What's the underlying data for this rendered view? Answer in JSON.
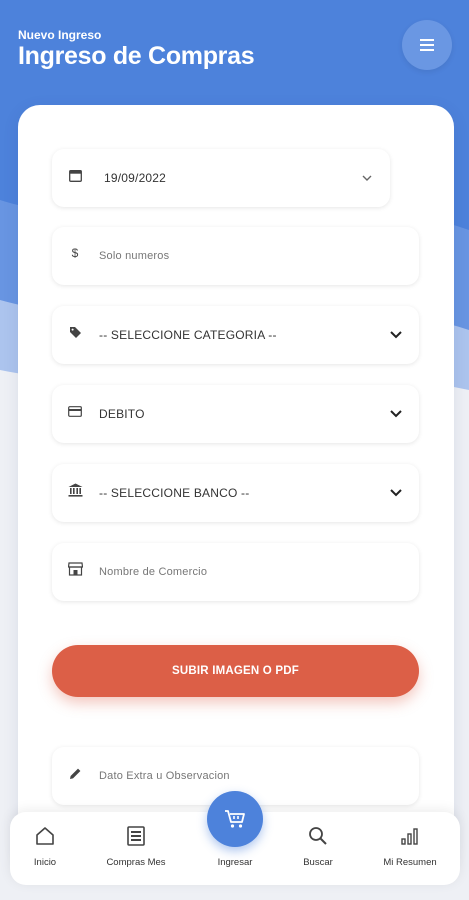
{
  "header": {
    "subtitle": "Nuevo Ingreso",
    "title": "Ingreso de Compras",
    "menu_icon": "hamburger-icon"
  },
  "form": {
    "date": {
      "icon": "calendar-icon",
      "value": "19/09/2022"
    },
    "amount": {
      "icon": "dollar-icon",
      "placeholder": "Solo numeros"
    },
    "category": {
      "icon": "tag-icon",
      "value": "-- SELECCIONE CATEGORIA --"
    },
    "payment": {
      "icon": "credit-card-icon",
      "value": "DEBITO"
    },
    "bank": {
      "icon": "bank-icon",
      "value": "-- SELECCIONE BANCO --"
    },
    "store": {
      "icon": "store-icon",
      "placeholder": "Nombre de Comercio"
    },
    "upload_label": "SUBIR IMAGEN O PDF",
    "notes": {
      "icon": "pencil-icon",
      "placeholder": "Dato Extra u Observacion"
    }
  },
  "nav": {
    "items": [
      {
        "label": "Inicio",
        "icon": "home-icon"
      },
      {
        "label": "Compras Mes",
        "icon": "receipt-icon"
      },
      {
        "label": "Ingresar",
        "icon": "cart-icon"
      },
      {
        "label": "Buscar",
        "icon": "search-icon"
      },
      {
        "label": "Mi Resumen",
        "icon": "bar-chart-icon"
      }
    ]
  },
  "colors": {
    "primary": "#4d82db",
    "accent": "#dc5f47",
    "background": "#eef0f5"
  }
}
